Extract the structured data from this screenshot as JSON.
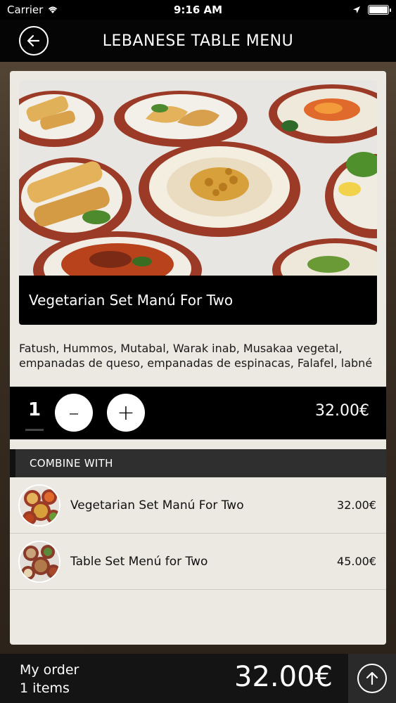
{
  "status_bar": {
    "carrier": "Carrier",
    "time": "9:16 AM"
  },
  "nav": {
    "title": "LEBANESE TABLE MENU",
    "back_icon": "back-arrow-icon"
  },
  "product": {
    "title": "Vegetarian Set Manú For Two",
    "description": "Fatush, Hummos, Mutabal, Warak inab, Musakaa vegetal, empanadas de queso, empanadas de espinacas, Falafel, labné",
    "quantity": "1",
    "minus_label": "–",
    "plus_label": "+",
    "price": "32.00€"
  },
  "combine": {
    "header": "COMBINE WITH",
    "items": [
      {
        "name": "Vegetarian Set Manú For Two",
        "price": "32.00€"
      },
      {
        "name": "Table Set Menú for Two",
        "price": "45.00€"
      }
    ]
  },
  "footer": {
    "order_label": "My order",
    "order_count": "1 items",
    "total": "32.00€"
  },
  "colors": {
    "accent": "#000000",
    "card_bg": "#ece9e2",
    "plate_rim": "#9b3a26"
  }
}
